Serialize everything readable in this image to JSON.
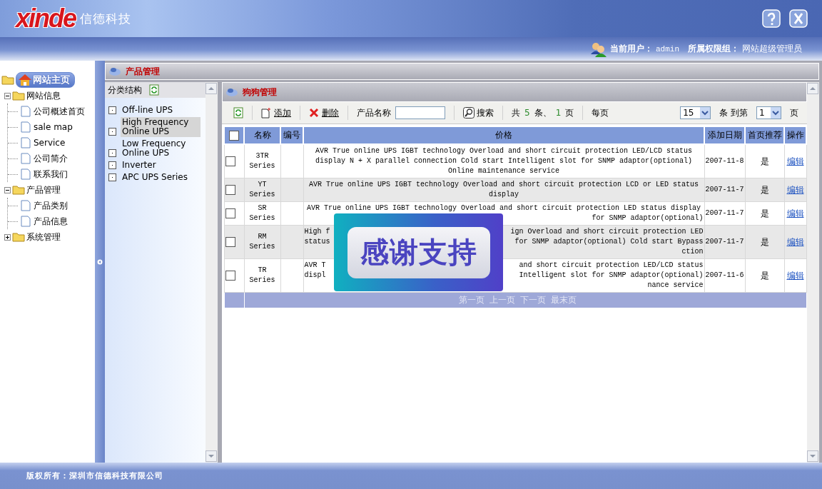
{
  "header": {
    "logo": "xinde",
    "company": "信德科技"
  },
  "user_bar": {
    "user_label": "当前用户：",
    "user": "admin",
    "group_label": "所属权限组：",
    "group": "网站超级管理员"
  },
  "tree": {
    "home": "网站主页",
    "items": [
      {
        "label": "网站信息",
        "expanded": true,
        "children": [
          {
            "label": "公司概述首页"
          },
          {
            "label": "sale map"
          },
          {
            "label": "Service"
          },
          {
            "label": "公司简介"
          },
          {
            "label": "联系我们"
          }
        ]
      },
      {
        "label": "产品管理",
        "expanded": true,
        "children": [
          {
            "label": "产品类别"
          },
          {
            "label": "产品信息"
          }
        ]
      },
      {
        "label": "系统管理",
        "expanded": false
      }
    ]
  },
  "section_title": "产品管理",
  "categories": {
    "title": "分类结构",
    "items": [
      {
        "label": "Off-line UPS",
        "selected": false
      },
      {
        "label": "High Frequency Online UPS",
        "selected": true
      },
      {
        "label": "Low Frequency Online UPS",
        "selected": false
      },
      {
        "label": "Inverter",
        "selected": false
      },
      {
        "label": "APC UPS Series",
        "selected": false
      }
    ]
  },
  "products": {
    "title": "狗狗管理",
    "toolbar": {
      "add": "添加",
      "delete": "删除",
      "name_label": "产品名称",
      "search": "搜索",
      "total_prefix": "共",
      "total": "5",
      "total_unit": "条、",
      "pages": "1",
      "pages_unit": "页",
      "per_page_label": "每页",
      "per_page": "15",
      "goto_label": "条 到第",
      "page": "1",
      "page_unit": "页"
    },
    "all_checked": false,
    "columns": [
      "名称",
      "编号",
      "价格",
      "添加日期",
      "首页推荐",
      "操作"
    ],
    "rows": [
      {
        "checked": false,
        "name": "3TR Series",
        "lines": [
          {
            "text": "AVR True online UPS IGBT technology Overload and short circuit protection LED/LCD status"
          },
          {
            "text": "display N + X parallel connection Cold start Intelligent slot for SNMP adaptor(optional)"
          },
          {
            "text": "Online maintenance service"
          }
        ],
        "date": "2007-11-8",
        "recommended": "是",
        "action": "编辑"
      },
      {
        "checked": false,
        "name": "YT Series",
        "lines": [
          {
            "text": "AVR True online UPS IGBT technology Overload and short circuit protection LCD or LED status"
          },
          {
            "text": "display"
          }
        ],
        "date": "2007-11-7",
        "recommended": "是",
        "action": "编辑"
      },
      {
        "checked": false,
        "name": "SR Series",
        "lines": [
          {
            "text": "AVR True online UPS IGBT technology Overload and short circuit protection LED status display"
          },
          {
            "right": "for SNMP adaptor(optional)"
          }
        ],
        "date": "2007-11-7",
        "recommended": "是",
        "action": "编辑"
      },
      {
        "checked": false,
        "name": "RM Series",
        "lines": [
          {
            "left": "High f",
            "right": "ign Overload and short circuit protection LED"
          },
          {
            "left": "status",
            "right": "for SNMP adaptor(optional) Cold start Bypass"
          },
          {
            "right": "ction"
          }
        ],
        "date": "2007-11-7",
        "recommended": "是",
        "action": "编辑"
      },
      {
        "checked": false,
        "name": "TR Series",
        "lines": [
          {
            "left": "AVR T",
            "right": "and short circuit protection LED/LCD status"
          },
          {
            "left": "displ",
            "right": "Intelligent slot for SNMP adaptor(optional)"
          },
          {
            "right": "nance service"
          }
        ],
        "date": "2007-11-6",
        "recommended": "是",
        "action": "编辑"
      }
    ],
    "pagination": [
      "第一页",
      "上一页",
      "下一页",
      "最末页"
    ]
  },
  "overlay": {
    "text": "感谢支持"
  },
  "footer": "版权所有：深圳市信德科技有限公司"
}
